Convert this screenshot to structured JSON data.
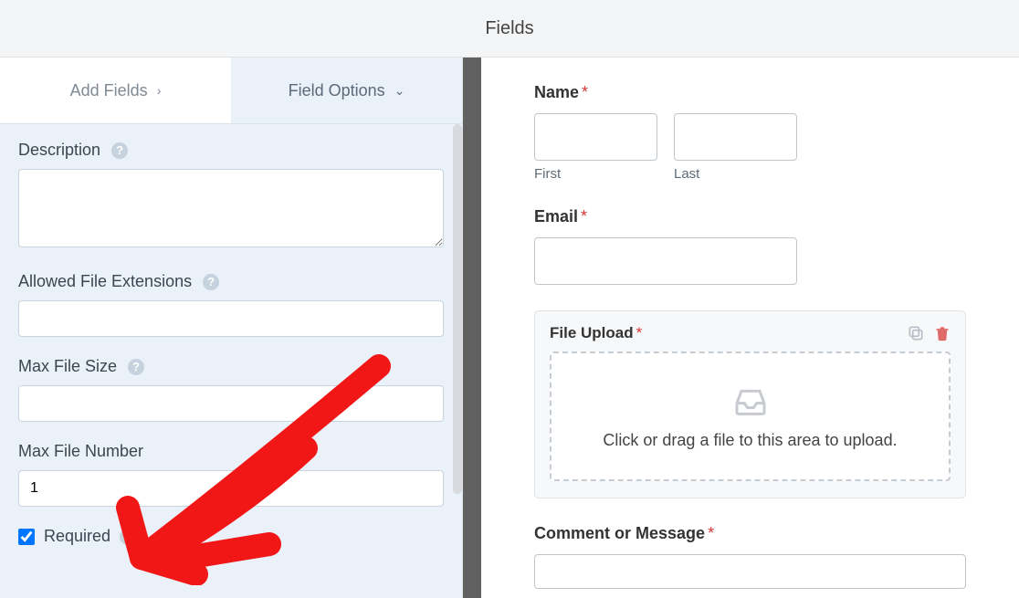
{
  "header": {
    "title": "Fields"
  },
  "sidebar": {
    "tabs": {
      "add": "Add Fields",
      "options": "Field Options"
    },
    "options": {
      "description_label": "Description",
      "description_value": "",
      "allowed_ext_label": "Allowed File Extensions",
      "allowed_ext_value": "",
      "max_size_label": "Max File Size",
      "max_size_value": "",
      "max_number_label": "Max File Number",
      "max_number_value": "1",
      "required_label": "Required",
      "required_checked": true
    }
  },
  "preview": {
    "name": {
      "label": "Name",
      "first": "First",
      "last": "Last"
    },
    "email": {
      "label": "Email"
    },
    "file_upload": {
      "label": "File Upload",
      "dropzone_text": "Click or drag a file to this area to upload."
    },
    "comment": {
      "label": "Comment or Message"
    }
  }
}
